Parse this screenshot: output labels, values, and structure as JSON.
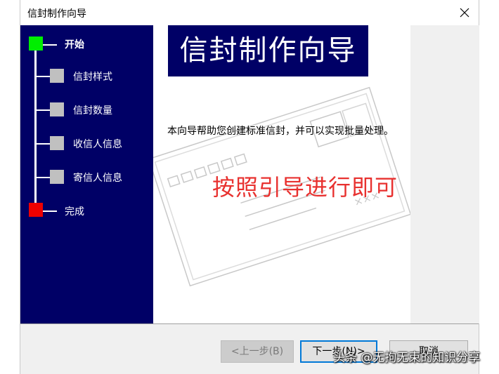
{
  "window": {
    "title": "信封制作向导"
  },
  "steps": [
    {
      "label": "开始",
      "state": "current",
      "color": "#00ee00"
    },
    {
      "label": "信封样式",
      "state": "pending",
      "color": "#c0c0c0"
    },
    {
      "label": "信封数量",
      "state": "pending",
      "color": "#c0c0c0"
    },
    {
      "label": "收信人信息",
      "state": "pending",
      "color": "#c0c0c0"
    },
    {
      "label": "寄信人信息",
      "state": "pending",
      "color": "#c0c0c0"
    },
    {
      "label": "完成",
      "state": "final",
      "color": "#ee0000"
    }
  ],
  "main": {
    "banner_title": "信封制作向导",
    "intro_text": "本向导帮助您创建标准信封，并可以实现批量处理。",
    "annotation": "按照引导进行即可",
    "envelope_stamp_text": "×××"
  },
  "buttons": {
    "prev": "<上一步(B)",
    "next": "下一步(N)>",
    "cancel": "取消"
  },
  "watermark": "头条 @无拘无束的知识分享",
  "colors": {
    "nav_bg": "#000066",
    "annotation": "#e8312f",
    "focus_border": "#0078d7"
  }
}
